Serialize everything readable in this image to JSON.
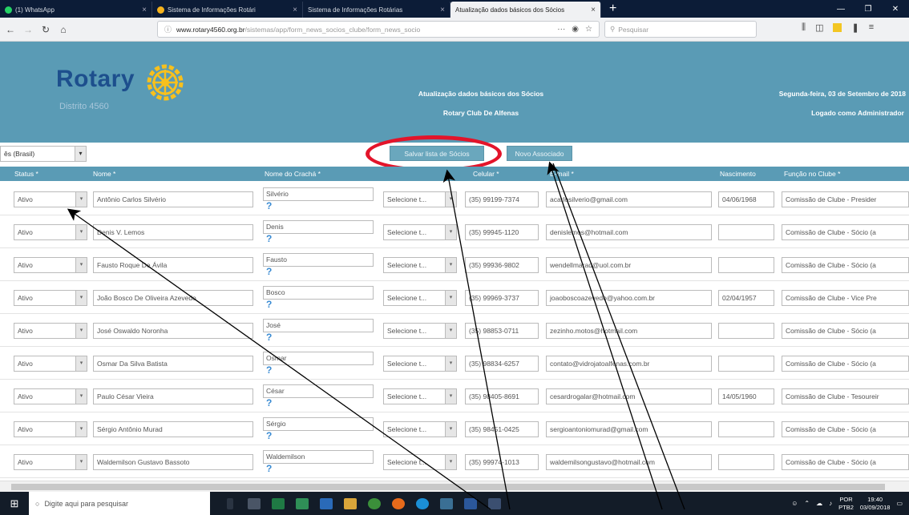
{
  "browser": {
    "tabs": [
      {
        "title": "(1) WhatsApp",
        "icon_color": "#25d366",
        "active": false
      },
      {
        "title": "Sistema de Informações Rotári",
        "icon_color": "#f5b21c",
        "active": false
      },
      {
        "title": "Sistema de Informações Rotárias",
        "icon_color": "#ffffff",
        "active": false
      },
      {
        "title": "Atualização dados básicos dos Sócios",
        "icon_color": "#ffffff",
        "active": true
      }
    ],
    "new_tab_label": "+",
    "url_host": "www.rotary4560.org.br",
    "url_path": "/sistemas/app/form_news_socios_clube/form_news_socio",
    "url_more": "···",
    "search_placeholder": "Pesquisar"
  },
  "header": {
    "logo_text": "Rotary",
    "logo_sub": "Distrito 4560",
    "page_title": "Atualização dados básicos dos Sócios",
    "club_name": "Rotary Club De Alfenas",
    "date_text": "Segunda-feira, 03 de Setembro de 2018",
    "user_text": "Logado como Administrador",
    "accent": "#5a9bb5",
    "logo_color": "#1d4f8d",
    "wheel_color": "#f7c01d"
  },
  "toolbar": {
    "language": "ês (Brasil)",
    "save_label": "Salvar lista de Sócios",
    "new_label": "Novo Associado"
  },
  "columns": {
    "status": "Status *",
    "nome": "Nome *",
    "cracha": "Nome do Crachá *",
    "sexo": "",
    "celular": "Celular *",
    "email": "E-mail *",
    "nascimento": "Nascimento",
    "funcao": "Função no Clube *"
  },
  "rows": [
    {
      "status": "Ativo",
      "nome": "Antônio Carlos Silvério",
      "cracha": "Silvério",
      "sexo": "Selecione t...",
      "celular": "(35) 99199-7374",
      "email": "acarlosilverio@gmail.com",
      "nascimento": "04/06/1968",
      "funcao": "Comissão de Clube - Presider"
    },
    {
      "status": "Ativo",
      "nome": "Denis V. Lemos",
      "cracha": "Denis",
      "sexo": "Selecione t...",
      "celular": "(35) 99945-1120",
      "email": "denislemos@hotmail.com",
      "nascimento": "",
      "funcao": "Comissão de Clube - Sócio (a"
    },
    {
      "status": "Ativo",
      "nome": "Fausto Roque De Ávila",
      "cracha": "Fausto",
      "sexo": "Selecione t...",
      "celular": "(35) 99936-9802",
      "email": "wendellmarad@uol.com.br",
      "nascimento": "",
      "funcao": "Comissão de Clube - Sócio (a"
    },
    {
      "status": "Ativo",
      "nome": "João Bosco De Oliveira Azevedo",
      "cracha": "Bosco",
      "sexo": "Selecione t...",
      "celular": "(35) 99969-3737",
      "email": "joaoboscoazevedo@yahoo.com.br",
      "nascimento": "02/04/1957",
      "funcao": "Comissão de Clube - Vice Pre"
    },
    {
      "status": "Ativo",
      "nome": "José Oswaldo Noronha",
      "cracha": "José",
      "sexo": "Selecione t...",
      "celular": "(35) 98853-0711",
      "email": "zezinho.motos@hotmail.com",
      "nascimento": "",
      "funcao": "Comissão de Clube - Sócio (a"
    },
    {
      "status": "Ativo",
      "nome": "Osmar Da Silva Batista",
      "cracha": "Osmar",
      "sexo": "Selecione t...",
      "celular": "(35) 98834-6257",
      "email": "contato@vidrojatoalfenas.com.br",
      "nascimento": "",
      "funcao": "Comissão de Clube - Sócio (a"
    },
    {
      "status": "Ativo",
      "nome": "Paulo César Vieira",
      "cracha": "César",
      "sexo": "Selecione t...",
      "celular": "(35) 98405-8691",
      "email": "cesardrogalar@hotmail.com",
      "nascimento": "14/05/1960",
      "funcao": "Comissão de Clube - Tesoureir"
    },
    {
      "status": "Ativo",
      "nome": "Sérgio Antônio Murad",
      "cracha": "Sérgio",
      "sexo": "Selecione t...",
      "celular": "(35) 98451-0425",
      "email": "sergioantoniomurad@gmail.com",
      "nascimento": "",
      "funcao": "Comissão de Clube - Sócio (a"
    },
    {
      "status": "Ativo",
      "nome": "Waldemilson Gustavo Bassoto",
      "cracha": "Waldemilson",
      "sexo": "Selecione t...",
      "celular": "(35) 99974-1013",
      "email": "waldemilsongustavo@hotmail.com",
      "nascimento": "",
      "funcao": "Comissão de Clube - Sócio (a"
    }
  ],
  "help_mark": "?",
  "taskbar": {
    "search_placeholder": "Digite aqui para pesquisar",
    "lang": "POR",
    "lang2": "PTB2",
    "time": "19:40",
    "date": "03/09/2018"
  },
  "annotation_color": "#e3142a"
}
